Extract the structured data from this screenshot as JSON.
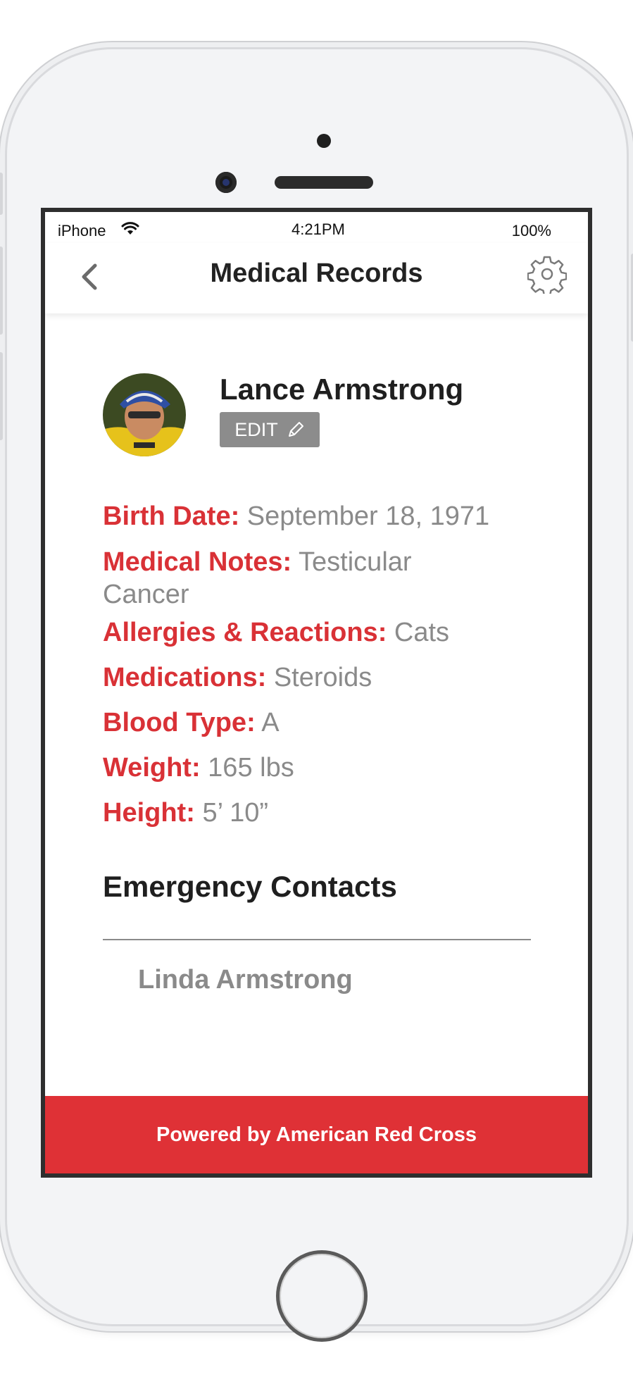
{
  "status_bar": {
    "carrier": "iPhone",
    "wifi_icon": "wifi-icon",
    "time": "4:21PM",
    "battery": "100%"
  },
  "navbar": {
    "back_icon": "chevron-left-icon",
    "title": "Medical Records",
    "settings_icon": "gear-icon"
  },
  "profile": {
    "name": "Lance Armstrong",
    "edit_label": "EDIT",
    "edit_icon": "pencil-icon"
  },
  "fields": [
    {
      "label": "Birth Date:",
      "value": "September 18, 1971"
    },
    {
      "label": "Medical Notes:",
      "value": "Testicular Cancer"
    },
    {
      "label": "Allergies & Reactions:",
      "value": "Cats"
    },
    {
      "label": "Medications:",
      "value": "Steroids"
    },
    {
      "label": "Blood Type:",
      "value": "A"
    },
    {
      "label": "Weight:",
      "value": "165 lbs"
    },
    {
      "label": "Height:",
      "value": "5’ 10”"
    }
  ],
  "emergency": {
    "title": "Emergency Contacts",
    "contacts": [
      {
        "name": "Linda Armstrong"
      }
    ]
  },
  "footer": {
    "text": "Powered by American Red Cross"
  },
  "colors": {
    "accent": "#df3136",
    "label": "#d93136",
    "value": "#8a8a8a",
    "edit_button": "#8c8c8c"
  }
}
